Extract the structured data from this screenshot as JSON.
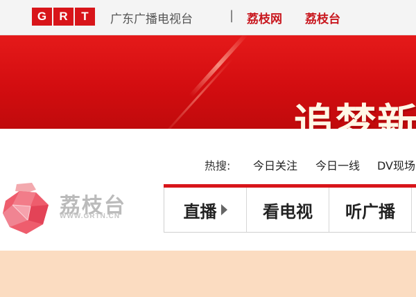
{
  "topbar": {
    "logo_letters": [
      "G",
      "R",
      "T"
    ],
    "station_name": "广东广播电视台",
    "divider": "|",
    "links": [
      "荔枝网",
      "荔枝台"
    ]
  },
  "banner": {
    "slogan": "追梦新"
  },
  "hot_search": {
    "label": "热搜:",
    "items": [
      "今日关注",
      "今日一线",
      "DV现场"
    ]
  },
  "site_logo": {
    "text": "荔枝台",
    "url": "WWW.GRTN.CN"
  },
  "menu": {
    "items": [
      "直播",
      "看电视",
      "听广播"
    ]
  },
  "colors": {
    "brand_red": "#d8151a",
    "banner_red": "#e51a1a",
    "beige": "#fbdcc1"
  }
}
